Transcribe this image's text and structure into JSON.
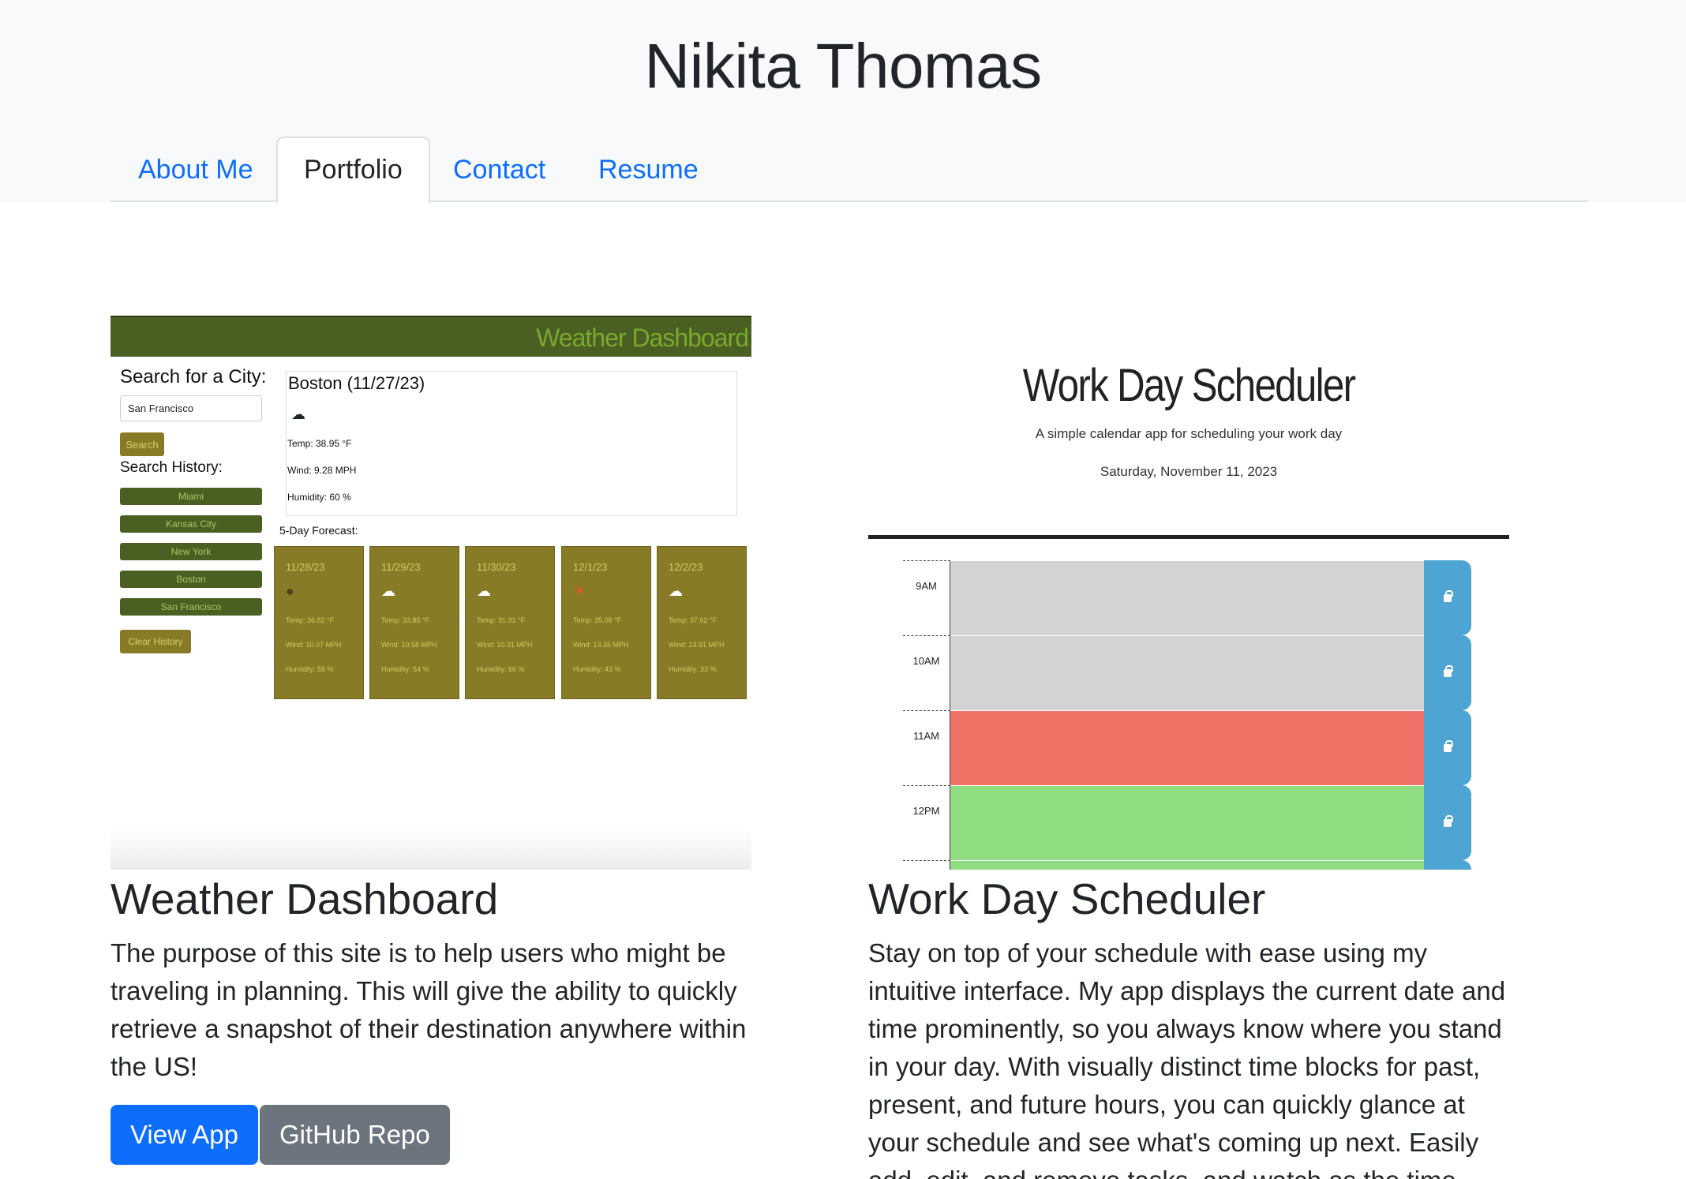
{
  "site": {
    "title": "Nikita Thomas"
  },
  "nav": {
    "tabs": [
      {
        "label": "About Me",
        "active": false
      },
      {
        "label": "Portfolio",
        "active": true
      },
      {
        "label": "Contact",
        "active": false
      },
      {
        "label": "Resume",
        "active": false
      }
    ]
  },
  "projects": [
    {
      "title": "Weather Dashboard",
      "description": "The purpose of this site is to help users who might be traveling in planning. This will give the ability to quickly retrieve a snapshot of their destination anywhere within the US!",
      "buttons": {
        "view": "View App",
        "repo": "GitHub Repo"
      },
      "screenshot": {
        "header": "Weather Dashboard",
        "search_label": "Search for a City:",
        "search_value": "San Francisco",
        "search_button": "Search",
        "history_label": "Search History:",
        "history": [
          "Miami",
          "Kansas City",
          "New York",
          "Boston",
          "San Francisco"
        ],
        "clear_button": "Clear History",
        "current": {
          "city": "Boston (11/27/23)",
          "icon": "partly-cloudy-icon",
          "temp": "Temp: 38.95 °F",
          "wind": "Wind: 9.28 MPH",
          "humidity": "Humidity: 60 %"
        },
        "forecast_label": "5-Day Forecast:",
        "forecast": [
          {
            "date": "11/28/23",
            "icon": "rain-icon",
            "temp": "Temp: 36.82 °F",
            "wind": "Wind: 10.07 MPH",
            "humidity": "Humidity: 58 %"
          },
          {
            "date": "11/29/23",
            "icon": "cloud-icon",
            "temp": "Temp: 33.85 °F",
            "wind": "Wind: 10.58 MPH",
            "humidity": "Humidity: 54 %"
          },
          {
            "date": "11/30/23",
            "icon": "cloud-icon",
            "temp": "Temp: 31.91 °F",
            "wind": "Wind: 10.31 MPH",
            "humidity": "Humidity: 66 %"
          },
          {
            "date": "12/1/23",
            "icon": "sun-icon",
            "temp": "Temp: 35.08 °F",
            "wind": "Wind: 13.35 MPH",
            "humidity": "Humidity: 43 %"
          },
          {
            "date": "12/2/23",
            "icon": "cloud-icon",
            "temp": "Temp: 37.62 °F",
            "wind": "Wind: 13.91 MPH",
            "humidity": "Humidity: 33 %"
          }
        ]
      }
    },
    {
      "title": "Work Day Scheduler",
      "description": "Stay on top of your schedule with ease using my intuitive interface. My app displays the current date and time prominently, so you always know where you stand in your day. With visually distinct time blocks for past, present, and future hours, you can quickly glance at your schedule and see what's coming up next. Easily add, edit, and remove tasks, and watch as the time",
      "screenshot": {
        "title": "Work Day Scheduler",
        "subtitle": "A simple calendar app for scheduling your work day",
        "date": "Saturday, November 11, 2023",
        "rows": [
          {
            "hour": "9AM",
            "state": "past"
          },
          {
            "hour": "10AM",
            "state": "past"
          },
          {
            "hour": "11AM",
            "state": "present"
          },
          {
            "hour": "12PM",
            "state": "future"
          }
        ]
      }
    }
  ],
  "colors": {
    "primary": "#0d6efd",
    "secondary": "#6c757d",
    "past": "#d3d3d3",
    "present": "#ee7266",
    "future": "#90dc81",
    "save": "#4ea4d2"
  }
}
